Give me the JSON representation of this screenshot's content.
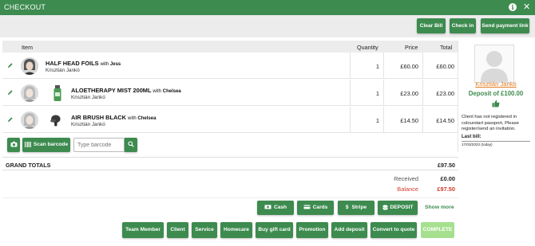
{
  "window": {
    "title": "CHECKOUT"
  },
  "actions": {
    "clear_bill": "Clear Bill",
    "check_in": "Check in",
    "send_payment_link": "Send payment link"
  },
  "table": {
    "headers": {
      "item": "Item",
      "quantity": "Quantity",
      "price": "Price",
      "total": "Total"
    },
    "rows": [
      {
        "name": "HALF HEAD FOILS",
        "with_text": "with",
        "with_name": "Jess",
        "staff": "Krisztián Jankó",
        "quantity": "1",
        "price": "£60.00",
        "total": "£60.00"
      },
      {
        "name": "ALOETHERAPY MIST 200ML",
        "with_text": "with",
        "with_name": "Chelsea",
        "staff": "Krisztián Jankó",
        "quantity": "1",
        "price": "£23.00",
        "total": "£23.00"
      },
      {
        "name": "AIR BRUSH BLACK",
        "with_text": "with",
        "with_name": "Chelsea",
        "staff": "Krisztián Jankó",
        "quantity": "1",
        "price": "£14.50",
        "total": "£14.50"
      }
    ]
  },
  "scan": {
    "scan_label": "Scan barcode",
    "barcode_placeholder": "Type barcode"
  },
  "totals": {
    "grand_label": "GRAND TOTALS",
    "grand_value": "£97.50",
    "received_label": "Received",
    "received_value": "£0.00",
    "balance_label": "Balance",
    "balance_value": "£97.50"
  },
  "payments": {
    "cash": "Cash",
    "cards": "Cards",
    "stripe": "Stripe",
    "deposit": "DEPOSIT",
    "show_more": "Show more"
  },
  "bottom": {
    "team_member": "Team Member",
    "client": "Client",
    "service": "Service",
    "homecare": "Homecare",
    "buy_gift_card": "Buy gift card",
    "promotion": "Promotion",
    "add_deposit": "Add deposit",
    "convert_to_quote": "Convert to quote",
    "complete": "COMPLETE"
  },
  "client": {
    "name": "Krisztián Jankó",
    "deposit": "Deposit of £100.00",
    "note": "Client has not registered in colourstart passport, Please register/send an invitation.",
    "last_bill_label": "Last bill:",
    "last_bill_date": "17/03/2023 (today)"
  },
  "colors": {
    "primary": "#3d8b4f",
    "complete_bg": "#a6e08f",
    "balance": "#d23b2c",
    "client_name": "#e27b1f"
  },
  "icons": [
    "info-icon",
    "close-icon",
    "pencil-icon",
    "camera-icon",
    "barcode-icon",
    "search-icon",
    "cash-icon",
    "card-icon",
    "dollar-icon",
    "deposit-icon",
    "thumbs-up-icon",
    "avatar-placeholder-icon"
  ]
}
